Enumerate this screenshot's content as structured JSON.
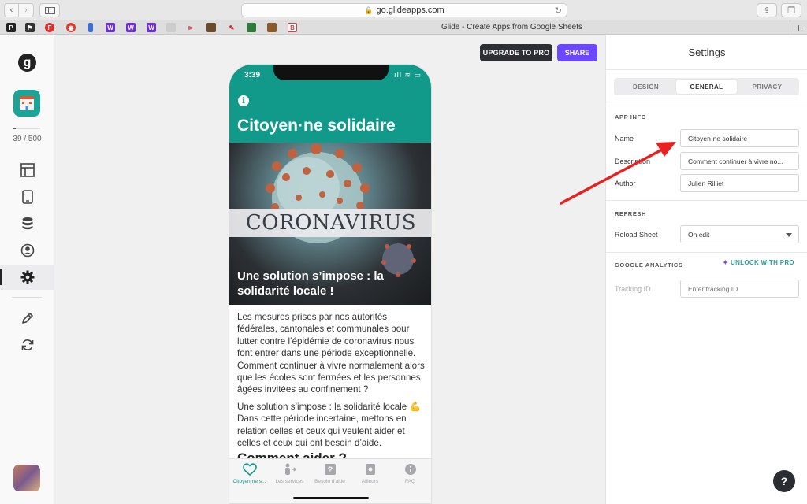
{
  "browser": {
    "url": "go.glideapps.com",
    "tab_title": "Glide - Create Apps from Google Sheets",
    "new_tab": "+"
  },
  "rail": {
    "logo": "g",
    "usage": "39 / 500",
    "usage_fraction": 0.078
  },
  "actions": {
    "upgrade": "UPGRADE TO PRO",
    "share": "SHARE"
  },
  "phone": {
    "time": "3:39",
    "status_icons": "ıIl ≋ ▭",
    "title": "Citoyen·ne solidaire",
    "hero_word": "CORONAVIRUS",
    "hero_caption": "Une solution s’impose : la solidarité locale !",
    "paragraph1": "Les mesures prises par nos autorités fédérales, cantonales et communales pour lutter contre l’épidémie de coronavirus nous font entrer dans une période exceptionnelle. Comment continuer à vivre normalement alors que les écoles sont fermées et les personnes âgées invitées au confinement ?",
    "paragraph2": "Une solution s’impose : la solidarité locale 💪 Dans cette période incertaine, mettons en relation celles et ceux qui veulent aider et celles et ceux qui ont besoin d’aide.",
    "heading2": "Comment aider ?",
    "tabs": [
      {
        "label": "Citoyen·ne s..."
      },
      {
        "label": "Les services"
      },
      {
        "label": "Besoin d'aide"
      },
      {
        "label": "Ailleurs"
      },
      {
        "label": "FAQ"
      }
    ]
  },
  "settings": {
    "title": "Settings",
    "tabs": [
      "DESIGN",
      "GENERAL",
      "PRIVACY"
    ],
    "app_info": {
      "heading": "APP INFO",
      "name_label": "Name",
      "name_value": "Citoyen·ne solidaire",
      "description_label": "Description",
      "description_value": "Comment continuer à vivre no...",
      "author_label": "Author",
      "author_value": "Julien Rilliet"
    },
    "refresh": {
      "heading": "REFRESH",
      "reload_label": "Reload Sheet",
      "reload_value": "On edit"
    },
    "analytics": {
      "heading": "GOOGLE ANALYTICS",
      "unlock": "UNLOCK WITH PRO",
      "tracking_label": "Tracking ID",
      "tracking_placeholder": "Enter tracking ID"
    }
  },
  "help": "?",
  "colors": {
    "brand_teal": "#119a8a",
    "accent_purple": "#6b48ff",
    "annotation_red": "#e8211f"
  }
}
